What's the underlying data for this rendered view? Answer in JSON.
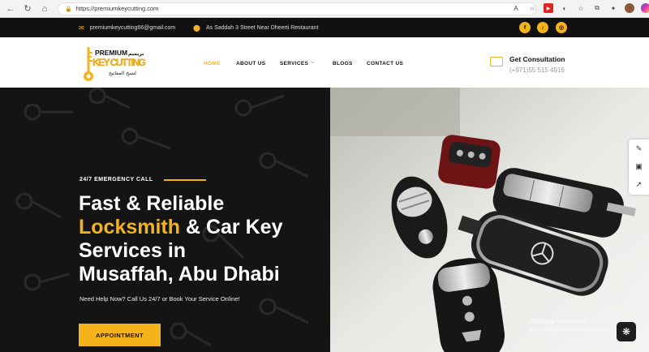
{
  "browser": {
    "url": "https://premiumkeycutting.com",
    "back_icon": "back-arrow",
    "refresh_icon": "refresh",
    "home_icon": "home",
    "lock_icon": "site-info"
  },
  "topbar": {
    "email": "premiumkeycutting66@gmail.com",
    "address": "As Saddah 3 Street Near Dheerti Restaurant",
    "social": [
      "f",
      "♪",
      "◎"
    ],
    "accent": "#f5b31b"
  },
  "header": {
    "logo_top": "PREMIUM",
    "logo_arabic_top": "بريميم",
    "logo_main": "KEY CUTTING",
    "logo_arabic_bottom": "لنسخ المفاتيح",
    "menu": [
      "HOME",
      "ABOUT US",
      "SERVICES",
      "BLOGS",
      "CONTACT US"
    ],
    "consult_title": "Get Consultation",
    "consult_phone": "(+971)55 515 4916"
  },
  "hero": {
    "eyebrow": "24/7 EMERGENCY CALL",
    "title_1": "Fast & Reliable",
    "title_highlight": "Locksmith",
    "title_2": " & Car Key",
    "title_3": "Services in",
    "title_4": "Musaffah, Abu Dhabi",
    "subtitle": "Need Help Now? Call Us 24/7 or Book Your Service Online!",
    "cta": "APPOINTMENT"
  },
  "overlay": {
    "activate_title": "Activate Windows",
    "activate_sub": "Go to Settings to activate Windows."
  }
}
